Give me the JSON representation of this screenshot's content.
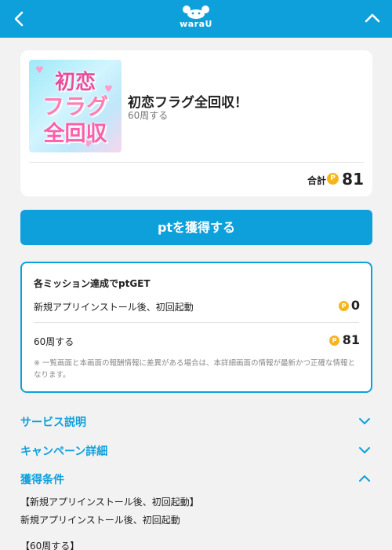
{
  "header": {
    "logo_text": "waraU",
    "back_icon": "chevron-left-icon",
    "collapse_icon": "chevron-up-icon",
    "background": "#0ea0db"
  },
  "offer": {
    "thumbnail_lines": [
      "初恋",
      "フラグ",
      "全回収"
    ],
    "title": "初恋フラグ全回収！",
    "subtitle": "60周する",
    "total_label": "合計",
    "coin_symbol": "P",
    "total_value": "81"
  },
  "cta": {
    "label": "ptを獲得する"
  },
  "missions": {
    "heading": "各ミッション達成でptGET",
    "items": [
      {
        "label": "新規アプリインストール後、初回起動",
        "value": "0"
      },
      {
        "label": "60周する",
        "value": "81"
      }
    ],
    "note": "※ 一覧画面と本画面の報酬情報に差異がある場合は、本詳細画面の情報が最新かつ正確な情報となります。"
  },
  "sections": [
    {
      "label": "サービス説明",
      "icon": "chevron-down-icon"
    },
    {
      "label": "キャンペーン詳細",
      "icon": "chevron-down-icon"
    },
    {
      "label": "獲得条件",
      "icon": "chevron-up-icon"
    }
  ],
  "conditions": [
    "【新規アプリインストール後、初回起動】",
    "新規アプリインストール後、初回起動",
    "【60周する】"
  ],
  "colors": {
    "accent": "#0ea0db",
    "coin": "#f5b51d",
    "background": "#f2f2f2"
  }
}
